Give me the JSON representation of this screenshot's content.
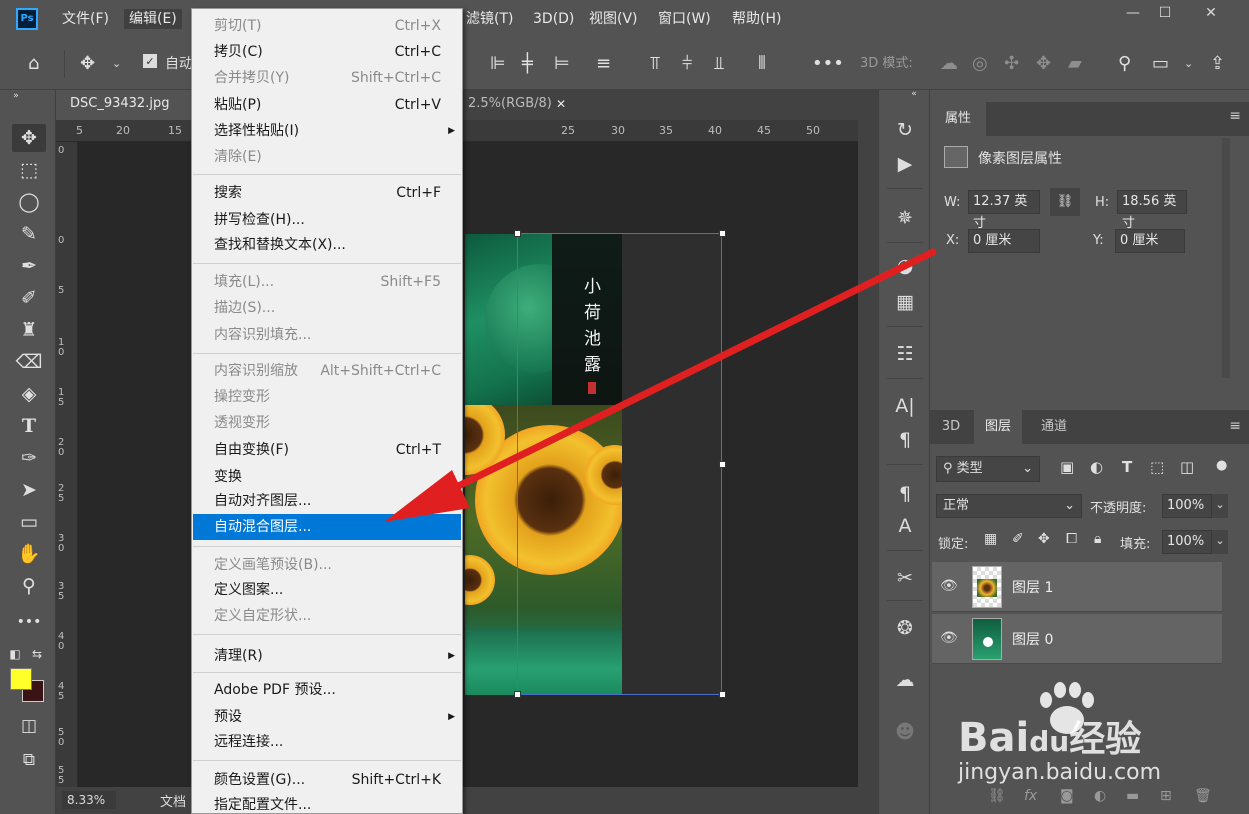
{
  "menubar": {
    "logo": "Ps",
    "items": [
      "文件(F)",
      "编辑(E)",
      "滤镜(T)",
      "3D(D)",
      "视图(V)",
      "窗口(W)",
      "帮助(H)"
    ],
    "window_buttons": [
      "—",
      "☐",
      "✕"
    ]
  },
  "options": {
    "auto_label": "自动",
    "mode_label": "3D 模式:"
  },
  "document": {
    "tab_active": "DSC_93432.jpg @",
    "tab_second": "2.5%(RGB/8)",
    "tab_close": "✕",
    "ruler_top": [
      "5",
      "20",
      "15",
      "25",
      "30",
      "35",
      "40",
      "45",
      "50"
    ],
    "ruler_left": [
      "0",
      "0",
      "5",
      "1 0",
      "1 5",
      "2 0",
      "2 5",
      "3 0",
      "3 5",
      "4 0",
      "4 5",
      "5 0",
      "5 5"
    ],
    "zoom": "8.33%",
    "status_text": "文档",
    "image_text": "小荷池露"
  },
  "edit_menu": {
    "items": [
      {
        "label": "剪切(T)",
        "shortcut": "Ctrl+X",
        "disabled": true
      },
      {
        "label": "拷贝(C)",
        "shortcut": "Ctrl+C",
        "disabled": false
      },
      {
        "label": "合并拷贝(Y)",
        "shortcut": "Shift+Ctrl+C",
        "disabled": true
      },
      {
        "label": "粘贴(P)",
        "shortcut": "Ctrl+V",
        "disabled": false
      },
      {
        "label": "选择性粘贴(I)",
        "shortcut": "",
        "disabled": false,
        "submenu": true
      },
      {
        "label": "清除(E)",
        "shortcut": "",
        "disabled": true
      },
      {
        "label": "搜索",
        "shortcut": "Ctrl+F",
        "disabled": false
      },
      {
        "label": "拼写检查(H)...",
        "shortcut": "",
        "disabled": false
      },
      {
        "label": "查找和替换文本(X)...",
        "shortcut": "",
        "disabled": false
      },
      {
        "label": "填充(L)...",
        "shortcut": "Shift+F5",
        "disabled": true
      },
      {
        "label": "描边(S)...",
        "shortcut": "",
        "disabled": true
      },
      {
        "label": "内容识别填充...",
        "shortcut": "",
        "disabled": true
      },
      {
        "label": "内容识别缩放",
        "shortcut": "Alt+Shift+Ctrl+C",
        "disabled": true
      },
      {
        "label": "操控变形",
        "shortcut": "",
        "disabled": true
      },
      {
        "label": "透视变形",
        "shortcut": "",
        "disabled": true
      },
      {
        "label": "自由变换(F)",
        "shortcut": "Ctrl+T",
        "disabled": false
      },
      {
        "label": "变换",
        "shortcut": "",
        "disabled": false,
        "submenu": true
      },
      {
        "label": "自动对齐图层...",
        "shortcut": "",
        "disabled": false
      },
      {
        "label": "自动混合图层...",
        "shortcut": "",
        "disabled": false,
        "highlighted": true
      },
      {
        "label": "定义画笔预设(B)...",
        "shortcut": "",
        "disabled": true
      },
      {
        "label": "定义图案...",
        "shortcut": "",
        "disabled": false
      },
      {
        "label": "定义自定形状...",
        "shortcut": "",
        "disabled": true
      },
      {
        "label": "清理(R)",
        "shortcut": "",
        "disabled": false,
        "submenu": true
      },
      {
        "label": "Adobe PDF 预设...",
        "shortcut": "",
        "disabled": false
      },
      {
        "label": "预设",
        "shortcut": "",
        "disabled": false,
        "submenu": true
      },
      {
        "label": "远程连接...",
        "shortcut": "",
        "disabled": false
      },
      {
        "label": "颜色设置(G)...",
        "shortcut": "Shift+Ctrl+K",
        "disabled": false
      },
      {
        "label": "指定配置文件...",
        "shortcut": "",
        "disabled": false
      }
    ]
  },
  "properties": {
    "tab": "属性",
    "title": "像素图层属性",
    "w_label": "W:",
    "w_value": "12.37 英寸",
    "h_label": "H:",
    "h_value": "18.56 英寸",
    "x_label": "X:",
    "x_value": "0 厘米",
    "y_label": "Y:",
    "y_value": "0 厘米"
  },
  "layers_panel": {
    "tabs": [
      "3D",
      "图层",
      "通道"
    ],
    "filter": "类型",
    "blend_mode": "正常",
    "opacity_label": "不透明度:",
    "opacity": "100%",
    "lock_label": "锁定:",
    "fill_label": "填充:",
    "fill": "100%",
    "layers": [
      {
        "name": "图层 1"
      },
      {
        "name": "图层 0"
      }
    ]
  },
  "watermark": {
    "brand": "Bai",
    "brand_mid": "du",
    "brand_cn": "经验",
    "url": "jingyan.baidu.com"
  },
  "colors": {
    "foreground": "#ffff2a",
    "background": "#3a1414",
    "highlight": "#0078d7",
    "arrow": "#e02020"
  }
}
